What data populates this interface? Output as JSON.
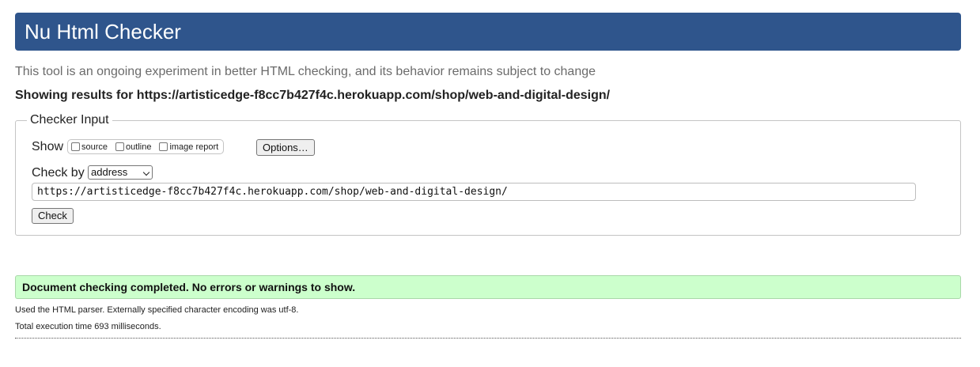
{
  "header": {
    "title": "Nu Html Checker"
  },
  "intro": {
    "text": "This tool is an ongoing experiment in better HTML checking, and its behavior remains subject to change"
  },
  "results": {
    "heading": "Showing results for https://artisticedge-f8cc7b427f4c.herokuapp.com/shop/web-and-digital-design/"
  },
  "checker_input": {
    "legend": "Checker Input",
    "show_label": "Show",
    "show_options": [
      {
        "label": "source",
        "checked": false
      },
      {
        "label": "outline",
        "checked": false
      },
      {
        "label": "image report",
        "checked": false
      }
    ],
    "options_button": "Options…",
    "check_by_label": "Check by",
    "check_by_selected": "address",
    "url_value": "https://artisticedge-f8cc7b427f4c.herokuapp.com/shop/web-and-digital-design/",
    "check_button": "Check"
  },
  "status": {
    "message": "Document checking completed. No errors or warnings to show.",
    "color": "#ccffcc"
  },
  "info": {
    "parser": "Used the HTML parser. Externally specified character encoding was utf-8.",
    "execution_time": "Total execution time 693 milliseconds."
  },
  "colors": {
    "banner": "#2f558c"
  }
}
